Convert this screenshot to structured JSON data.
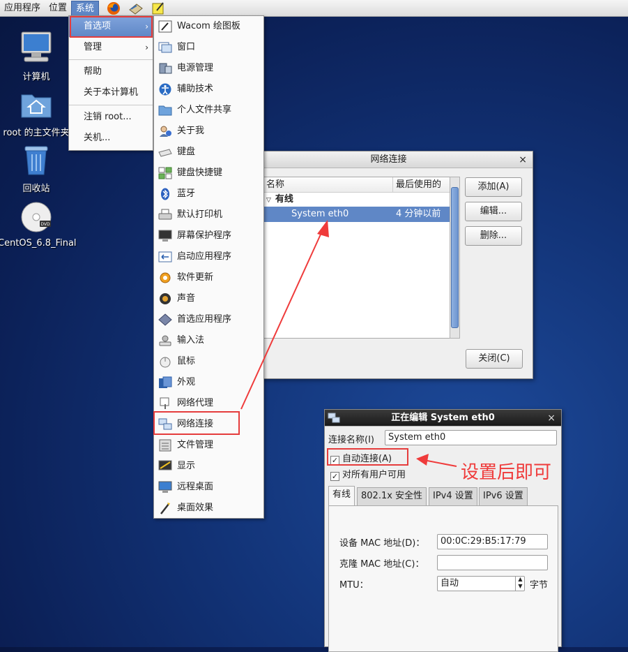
{
  "panel": {
    "menus": [
      "应用程序",
      "位置",
      "系统"
    ],
    "launchers": [
      "firefox-icon",
      "email-icon",
      "notes-icon"
    ]
  },
  "desktop": {
    "icons": [
      {
        "name": "computer-icon",
        "label": "计算机"
      },
      {
        "name": "home-folder-icon",
        "label": "root 的主文件夹"
      },
      {
        "name": "trash-icon",
        "label": "回收站"
      },
      {
        "name": "dvd-icon",
        "label": "CentOS_6.8_Final"
      }
    ]
  },
  "system_menu": {
    "items": [
      {
        "label": "首选项",
        "submenu": true
      },
      {
        "label": "管理",
        "submenu": true
      },
      {
        "label": "帮助"
      },
      {
        "label": "关于本计算机"
      },
      {
        "label": "注销 root..."
      },
      {
        "label": "关机..."
      }
    ],
    "arrow": "›"
  },
  "preferences_menu": {
    "items": [
      {
        "label": "Wacom 绘图板",
        "icon": "tablet-icon"
      },
      {
        "label": "窗口",
        "icon": "window-icon"
      },
      {
        "label": "电源管理",
        "icon": "power-icon"
      },
      {
        "label": "辅助技术",
        "icon": "accessibility-icon"
      },
      {
        "label": "个人文件共享",
        "icon": "folder-share-icon"
      },
      {
        "label": "关于我",
        "icon": "about-me-icon"
      },
      {
        "label": "键盘",
        "icon": "keyboard-icon"
      },
      {
        "label": "键盘快捷键",
        "icon": "shortcut-icon"
      },
      {
        "label": "蓝牙",
        "icon": "bluetooth-icon"
      },
      {
        "label": "默认打印机",
        "icon": "printer-icon"
      },
      {
        "label": "屏幕保护程序",
        "icon": "screensaver-icon"
      },
      {
        "label": "启动应用程序",
        "icon": "startup-icon"
      },
      {
        "label": "软件更新",
        "icon": "update-icon"
      },
      {
        "label": "声音",
        "icon": "sound-icon"
      },
      {
        "label": "首选应用程序",
        "icon": "preferred-apps-icon"
      },
      {
        "label": "输入法",
        "icon": "input-method-icon"
      },
      {
        "label": "鼠标",
        "icon": "mouse-icon"
      },
      {
        "label": "外观",
        "icon": "appearance-icon"
      },
      {
        "label": "网络代理",
        "icon": "proxy-icon"
      },
      {
        "label": "网络连接",
        "icon": "network-icon"
      },
      {
        "label": "文件管理",
        "icon": "file-manager-icon"
      },
      {
        "label": "显示",
        "icon": "display-icon"
      },
      {
        "label": "远程桌面",
        "icon": "remote-desktop-icon"
      },
      {
        "label": "桌面效果",
        "icon": "desktop-effects-icon"
      }
    ]
  },
  "net_window": {
    "title": "网络连接",
    "close": "×",
    "columns": [
      "名称",
      "最后使用的"
    ],
    "group": "有线",
    "row": {
      "name": "System eth0",
      "last_used": "4 分钟以前"
    },
    "buttons": {
      "add": "添加(A)",
      "edit": "编辑...",
      "delete": "删除...",
      "close": "关闭(C)"
    }
  },
  "edit_window": {
    "title": "正在编辑 System eth0",
    "close": "×",
    "name_label": "连接名称(I)",
    "name_value": "System eth0",
    "auto_connect": "自动连接(A)",
    "all_users": "对所有用户可用",
    "check": "✓",
    "tabs": [
      "有线",
      "802.1x 安全性",
      "IPv4 设置",
      "IPv6 设置"
    ],
    "mac_label": "设备 MAC 地址(D)：",
    "mac_value": "00:0C:29:B5:17:79",
    "clone_label": "克隆 MAC 地址(C)：",
    "clone_value": "",
    "mtu_label": "MTU：",
    "mtu_value": "自动",
    "mtu_unit": "字节"
  },
  "annotation": {
    "text": "设置后即可",
    "color": "#ef3b3b"
  }
}
